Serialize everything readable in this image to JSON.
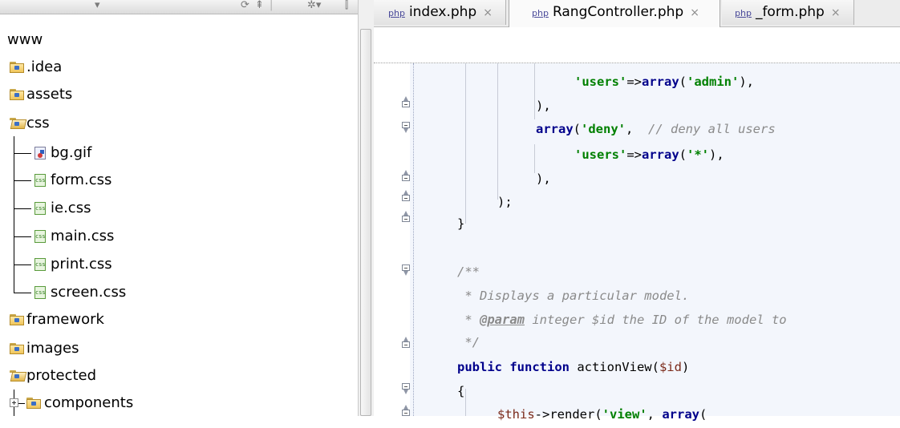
{
  "project_tree": {
    "root": "www",
    "items": [
      {
        "label": ".idea",
        "kind": "folder"
      },
      {
        "label": "assets",
        "kind": "folder"
      },
      {
        "label": "css",
        "kind": "folder-open"
      },
      {
        "label": "bg.gif",
        "kind": "gif"
      },
      {
        "label": "form.css",
        "kind": "css"
      },
      {
        "label": "ie.css",
        "kind": "css"
      },
      {
        "label": "main.css",
        "kind": "css"
      },
      {
        "label": "print.css",
        "kind": "css"
      },
      {
        "label": "screen.css",
        "kind": "css"
      },
      {
        "label": "framework",
        "kind": "folder"
      },
      {
        "label": "images",
        "kind": "folder"
      },
      {
        "label": "protected",
        "kind": "folder-open"
      },
      {
        "label": "components",
        "kind": "folder"
      }
    ],
    "css_icon_text": "css"
  },
  "tabs": [
    {
      "prefix": "php",
      "label": "index.php",
      "close": "×"
    },
    {
      "prefix": "php",
      "label": "RangController.php",
      "close": "×"
    },
    {
      "prefix": "php",
      "label": "_form.php",
      "close": "×"
    }
  ],
  "code": {
    "l1_str": "'users'",
    "l1_op": "=>",
    "l1_kw": "array",
    "l1_open": "(",
    "l1_str2": "'admin'",
    "l1_close": "),",
    "l2": "),",
    "l3_kw": "array",
    "l3_open": "(",
    "l3_str": "'deny'",
    "l3_sep": ",  ",
    "l3_cmt": "// deny all users",
    "l4_str": "'users'",
    "l4_op": "=>",
    "l4_kw": "array",
    "l4_open": "(",
    "l4_str2": "'*'",
    "l4_close": "),",
    "l5": "),",
    "l6": ");",
    "l7": "}",
    "l8": "/**",
    "l9": " * Displays a particular model.",
    "l10_star": " * ",
    "l10_tag": "@param",
    "l10_rest": " integer $id the ID of the model to ",
    "l11": " */",
    "l12_kw": "public function",
    "l12_rest": " actionView(",
    "l12_var": "$id",
    "l12_close": ")",
    "l13": "{",
    "l14_var": "$this",
    "l14_op": "->render(",
    "l14_str": "'view'",
    "l14_sep": ", ",
    "l14_kw": "array",
    "l14_open": "("
  }
}
